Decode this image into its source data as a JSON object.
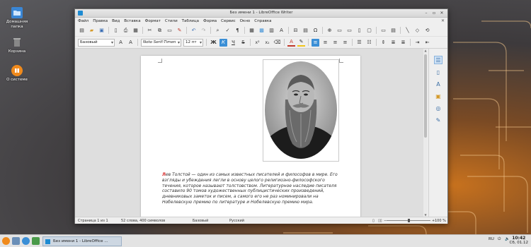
{
  "desktop": {
    "icons": [
      {
        "label": "Домашняя папка",
        "icon": "home-folder-icon"
      },
      {
        "label": "Корзина",
        "icon": "trash-icon"
      },
      {
        "label": "О системе",
        "icon": "about-system-icon"
      }
    ]
  },
  "window": {
    "title": "Без имени 1 - LibreOffice Writer"
  },
  "menubar": {
    "items": [
      "Файл",
      "Правка",
      "Вид",
      "Вставка",
      "Формат",
      "Стили",
      "Таблица",
      "Форма",
      "Сервис",
      "Окно",
      "Справка"
    ]
  },
  "formatting": {
    "paragraph_style": "Базовый",
    "font_name": "Noto Serif:Timen",
    "font_size": "12 пт",
    "bold": "Ж",
    "italic": "К",
    "underline": "Ч",
    "strike": "S",
    "superscript": "x²",
    "subscript": "x₂"
  },
  "document": {
    "dropcap": "Л",
    "text": "ев Толстой — один из самых известных писателей и философов в мире. Его взгляды и убеждения легли в основу целого религиозно-философского течения, которое называют толстовством. Литературное наследие писателя составило 90 томов художественных публицистических произведений, дневниковых заметок и писем, а самого его не раз номинировали на Нобелевскую премию по литературе и Нобелевскую премию мира."
  },
  "statusbar": {
    "page": "Страница 1 из 1",
    "words": "52 слова, 400 символов",
    "style": "Базовый",
    "language": "Русский",
    "zoom": "100 %"
  },
  "taskbar": {
    "task_label": "Без имени 1 - LibreOffice ...",
    "keyboard_layout": "RU",
    "time": "10:42",
    "date": "Сб, 01.12"
  },
  "colors": {
    "accent": "#3b8fd6",
    "dropcap": "#d62020"
  }
}
